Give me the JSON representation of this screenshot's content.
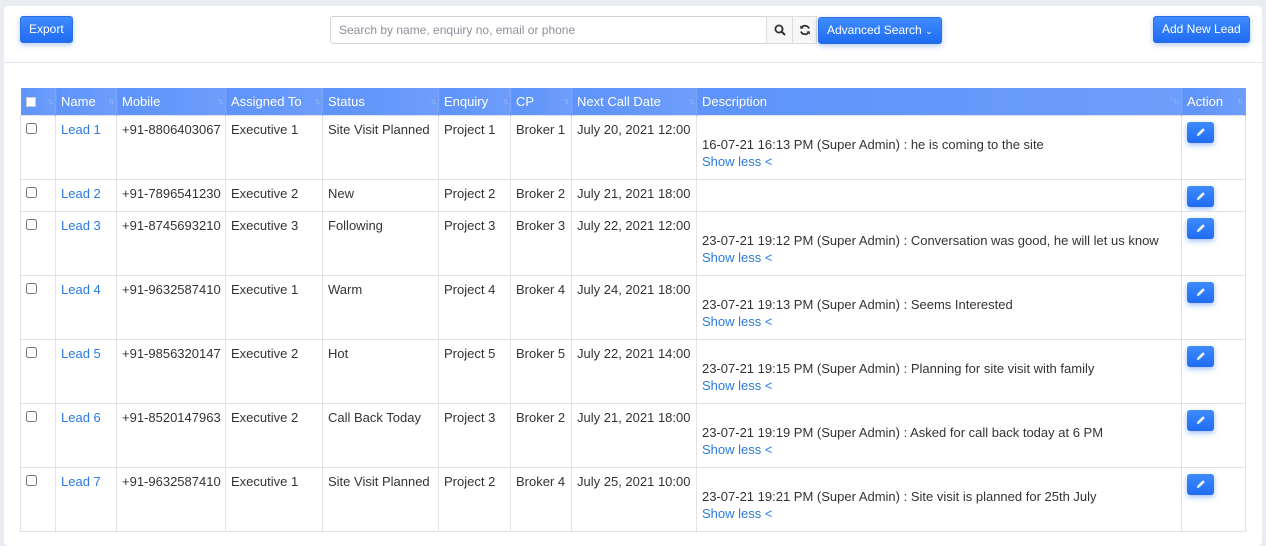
{
  "toolbar": {
    "export_label": "Export",
    "search_placeholder": "Search by name, enquiry no, email or phone",
    "search_value": "",
    "advanced_search_label": "Advanced Search",
    "add_lead_label": "Add New Lead"
  },
  "table": {
    "columns": [
      "",
      "Name",
      "Mobile",
      "Assigned To",
      "Status",
      "Enquiry",
      "CP",
      "Next Call Date",
      "Description",
      "Action"
    ],
    "show_less_label": "Show less <",
    "rows": [
      {
        "name": "Lead 1",
        "mobile": "+91-8806403067",
        "assigned": "Executive 1",
        "status": "Site Visit Planned",
        "enquiry": "Project 1",
        "cp": "Broker 1",
        "next_call": "July 20, 2021 12:00",
        "description": "16-07-21 16:13 PM (Super Admin) : he is coming to the site",
        "show_less": "Show less <"
      },
      {
        "name": "Lead 2",
        "mobile": "+91-7896541230",
        "assigned": "Executive 2",
        "status": "New",
        "enquiry": "Project 2",
        "cp": "Broker 2",
        "next_call": "July 21, 2021 18:00",
        "description": "",
        "show_less": ""
      },
      {
        "name": "Lead 3",
        "mobile": "+91-8745693210",
        "assigned": "Executive 3",
        "status": "Following",
        "enquiry": "Project 3",
        "cp": "Broker 3",
        "next_call": "July 22, 2021 12:00",
        "description": "23-07-21 19:12 PM (Super Admin) : Conversation was good, he will let us know",
        "show_less": "Show less <"
      },
      {
        "name": "Lead 4",
        "mobile": "+91-9632587410",
        "assigned": "Executive 1",
        "status": "Warm",
        "enquiry": "Project 4",
        "cp": "Broker 4",
        "next_call": "July 24, 2021 18:00",
        "description": "23-07-21 19:13 PM (Super Admin) : Seems Interested",
        "show_less": "Show less <"
      },
      {
        "name": "Lead 5",
        "mobile": "+91-9856320147",
        "assigned": "Executive 2",
        "status": "Hot",
        "enquiry": "Project 5",
        "cp": "Broker 5",
        "next_call": "July 22, 2021 14:00",
        "description": "23-07-21 19:15 PM (Super Admin) : Planning for site visit with family",
        "show_less": "Show less <"
      },
      {
        "name": "Lead 6",
        "mobile": "+91-8520147963",
        "assigned": "Executive 2",
        "status": "Call Back Today",
        "enquiry": "Project 3",
        "cp": "Broker 2",
        "next_call": "July 21, 2021 18:00",
        "description": "23-07-21 19:19 PM (Super Admin) : Asked for call back today at 6 PM",
        "show_less": "Show less <"
      },
      {
        "name": "Lead 7",
        "mobile": "+91-9632587410",
        "assigned": "Executive 1",
        "status": "Site Visit Planned",
        "enquiry": "Project 2",
        "cp": "Broker 4",
        "next_call": "July 25, 2021 10:00",
        "description": "23-07-21 19:21 PM (Super Admin) : Site visit is planned for 25th July",
        "show_less": "Show less <"
      }
    ]
  },
  "colors": {
    "primary": "#1f6cf3",
    "header_bg": "#6699ff",
    "link": "#2a7ae2"
  }
}
